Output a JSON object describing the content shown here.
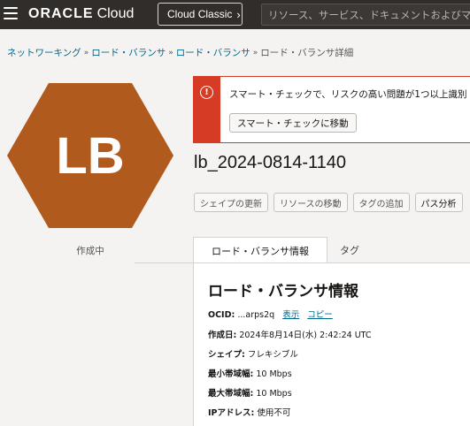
{
  "header": {
    "logo_oracle": "ORACLE",
    "logo_cloud": "Cloud",
    "classic_label": "Cloud Classic",
    "search_placeholder": "リソース、サービス、ドキュメントおよびマーケ"
  },
  "breadcrumb": {
    "items": [
      "ネットワーキング",
      "ロード・バランサ",
      "ロード・バランサ"
    ],
    "current": "ロード・バランサ詳細"
  },
  "resource_icon": {
    "initials": "LB",
    "color": "#b05a1e",
    "status": "作成中"
  },
  "alert": {
    "message": "スマート・チェックで、リスクの高い問題が1つ以上識別",
    "button_label": "スマート・チェックに移動",
    "color": "#d63b25"
  },
  "title": "lb_2024-0814-1140",
  "actions": [
    "シェイプの更新",
    "リソースの移動",
    "タグの追加",
    "パス分析"
  ],
  "tabs": {
    "active": "ロード・バランサ情報",
    "other": "タグ"
  },
  "panel": {
    "title": "ロード・バランサ情報",
    "ocid_label": "OCID:",
    "ocid_value": "...arps2q",
    "ocid_show": "表示",
    "ocid_copy": "コピー",
    "created_label": "作成日:",
    "created_value": "2024年8月14日(水) 2:42:24 UTC",
    "shape_label": "シェイプ:",
    "shape_value": "フレキシブル",
    "min_bw_label": "最小帯域幅:",
    "min_bw_value": "10 Mbps",
    "max_bw_label": "最大帯域幅:",
    "max_bw_value": "10 Mbps",
    "ip_label": "IPアドレス:",
    "ip_value": "使用不可"
  }
}
